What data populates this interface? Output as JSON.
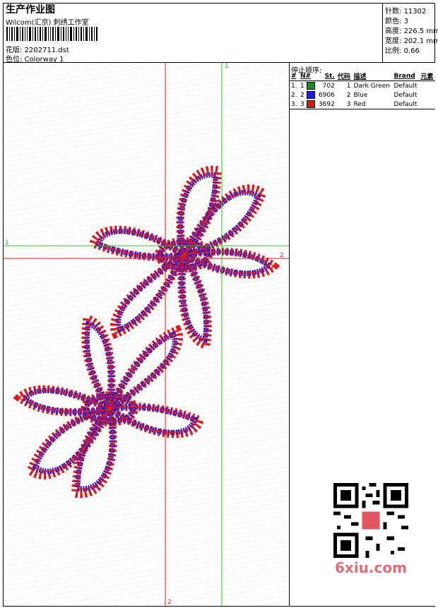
{
  "header": {
    "title": "生产作业图",
    "company": "Wilcom(汇京) 刺绣工作室",
    "pattern_label": "花版:",
    "pattern_value": "2202711.dst",
    "colorway_label": "色位:",
    "colorway_value": "Colorway 1"
  },
  "stats": [
    {
      "label": "针数:",
      "value": "11302"
    },
    {
      "label": "颜色:",
      "value": "3"
    },
    {
      "label": "高度:",
      "value": "226.5 mm"
    },
    {
      "label": "宽度:",
      "value": "202.1 mm"
    },
    {
      "label": "比例:",
      "value": "0.66"
    }
  ],
  "panel": {
    "stop_sequence_label": "停止顺序:",
    "columns": [
      "#",
      "N#",
      "St.",
      "代码",
      "描述",
      "Brand",
      "元素"
    ],
    "rows": [
      {
        "idx": "1.",
        "n": "1",
        "color": "#1a8a2a",
        "stitches": "702",
        "code": "1",
        "desc": "Dark Green",
        "brand": "Default"
      },
      {
        "idx": "2.",
        "n": "2",
        "color": "#1c1cdd",
        "stitches": "6906",
        "code": "2",
        "desc": "Blue",
        "brand": "Default"
      },
      {
        "idx": "3.",
        "n": "3",
        "color": "#e01818",
        "stitches": "3692",
        "code": "3",
        "desc": "Red",
        "brand": "Default"
      }
    ]
  },
  "guides": {
    "green_top": "1",
    "green_left": "1",
    "red_right": "2",
    "red_bottom": "2"
  },
  "watermark": "6xiu.com",
  "colors": {
    "blue": "#1c1cdd",
    "red": "#e01818",
    "green": "#22cc22"
  }
}
